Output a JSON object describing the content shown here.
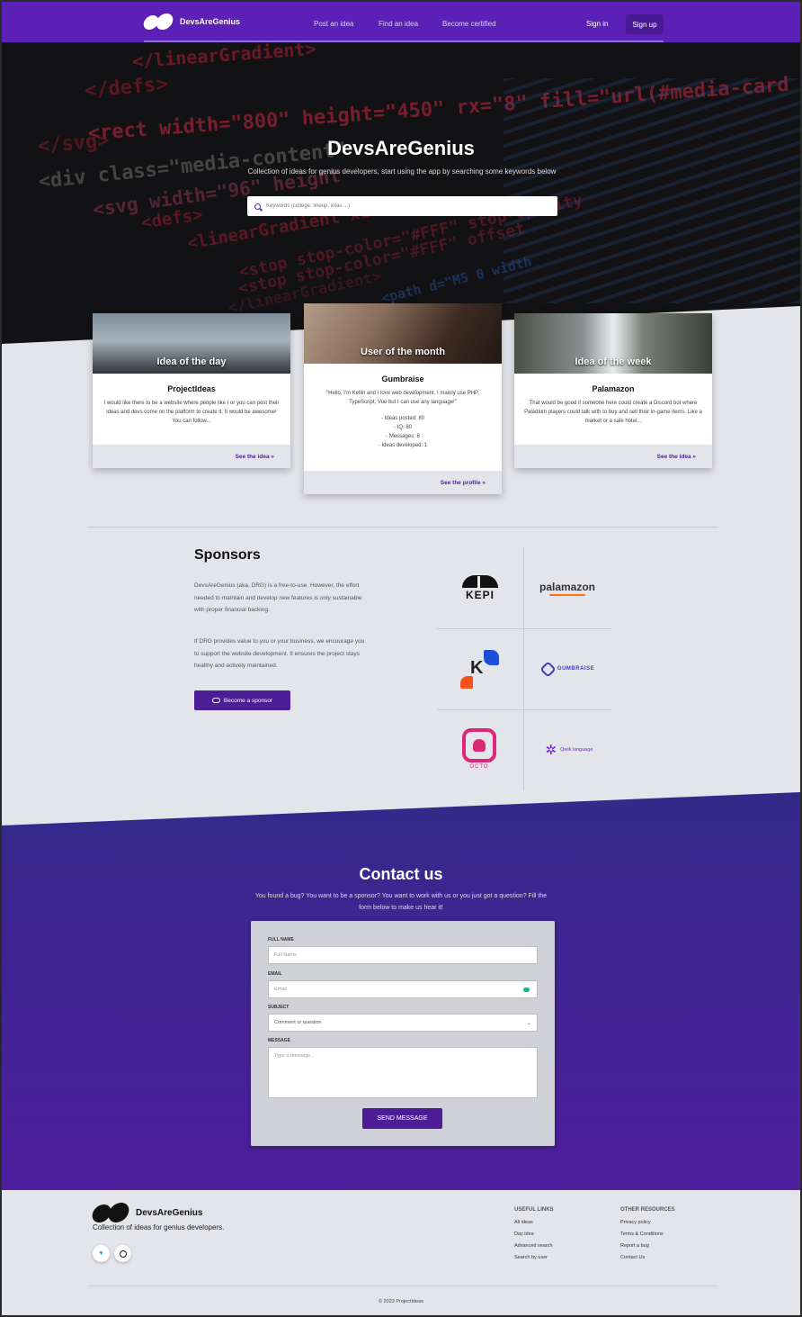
{
  "nav": {
    "brand": "DevsAreGenius",
    "links": [
      "Post an idea",
      "Find an idea",
      "Become certified"
    ],
    "sign_in": "Sign in",
    "sign_up": "Sign up"
  },
  "hero": {
    "code_lines": [
      "</linearGradient>",
      "</defs>",
      "<rect width=\"800\" height=\"450\" rx=\"8\" fill=\"url(#media-card",
      "</svg>",
      "<div class=\"media-content\"",
      "<svg width=\"96\" height",
      "<defs>",
      "<linearGradient x1",
      "<stop stop-color=\"#FFF\" stop-opacity",
      "<stop stop-color=\"#FFF\" offset",
      "</linearGradient>",
      "<path d=\"M5 0 width"
    ],
    "title": "DevsAreGenius",
    "subtitle": "Collection of ideas for genius developers, start using the app by searching some keywords below",
    "search_placeholder": "Keywords (college, lineup, iotas ...)"
  },
  "cards": [
    {
      "header": "Idea of the day",
      "name": "ProjectIdeas",
      "text": "I would like there to be a website where people like I or you can post their ideas and devs come on the platform to create it. It would be awesome! You can follow...",
      "link": "See the idea »"
    },
    {
      "header": "User of the month",
      "name": "Gumbraise",
      "text": "\"Hello, I'm Kellin and I love web development. I mainly use PHP, TypeScript, Vue but I can use any language!\"",
      "stats": [
        "- Ideas posted: 80",
        "- IQ: 80",
        "- Messages: 8",
        "- Ideas developed: 1"
      ],
      "link": "See the profile »"
    },
    {
      "header": "Idea of the week",
      "name": "Palamazon",
      "text": "That would be good if someone here could create a Discord bot where Paladium players could talk with to buy and sell their in-game items. Like a market or a sale hotel...",
      "link": "See the idea »"
    }
  ],
  "sponsors": {
    "title": "Sponsors",
    "paragraph1": "DevsAreGenius (aka, DRG) is a free-to-use. However, the effort needed to maintain and develop new features is only sustainable with proper financial backing.",
    "paragraph2": "If DRG provides value to you or your business, we encourage you to support the website development. It ensures the project stays healthy and actively maintained.",
    "button": "Become a sponsor",
    "logos": {
      "kepi": "KEPI",
      "palamazon": "palamazon",
      "k": "K",
      "gumbraise": "GUMBRAISE",
      "qwik": "Qwik language",
      "octo": "OCTO"
    }
  },
  "contact": {
    "title": "Contact us",
    "subtitle": "You found a bug? You want to be a sponsor? You want to work with us or you just got a question? Fill the form below to make us hear it!",
    "full_name_label": "FULL NAME",
    "full_name_placeholder": "Full Name",
    "email_label": "EMAIL",
    "email_placeholder": "Email",
    "subject_label": "SUBJECT",
    "subject_value": "Comment or question",
    "message_label": "MESSAGE",
    "message_placeholder": "Type a message...",
    "send": "SEND MESSAGE"
  },
  "footer": {
    "brand": "DevsAreGenius",
    "tagline": "Collection of ideas for genius developers.",
    "useful_title": "USEFUL LINKS",
    "useful_links": [
      "All ideas",
      "Day idea",
      "Advanced search",
      "Search by user"
    ],
    "other_title": "OTHER RESOURCES",
    "other_links": [
      "Privacy policy",
      "Terms & Conditions",
      "Report a bug",
      "Contact Us"
    ],
    "copyright": "© 2023 ProjectIdeas"
  },
  "colors": {
    "primary": "#5b21b6",
    "dark_purple": "#4c1d95",
    "background": "#e4e5ea",
    "hero_dark": "#121214"
  }
}
